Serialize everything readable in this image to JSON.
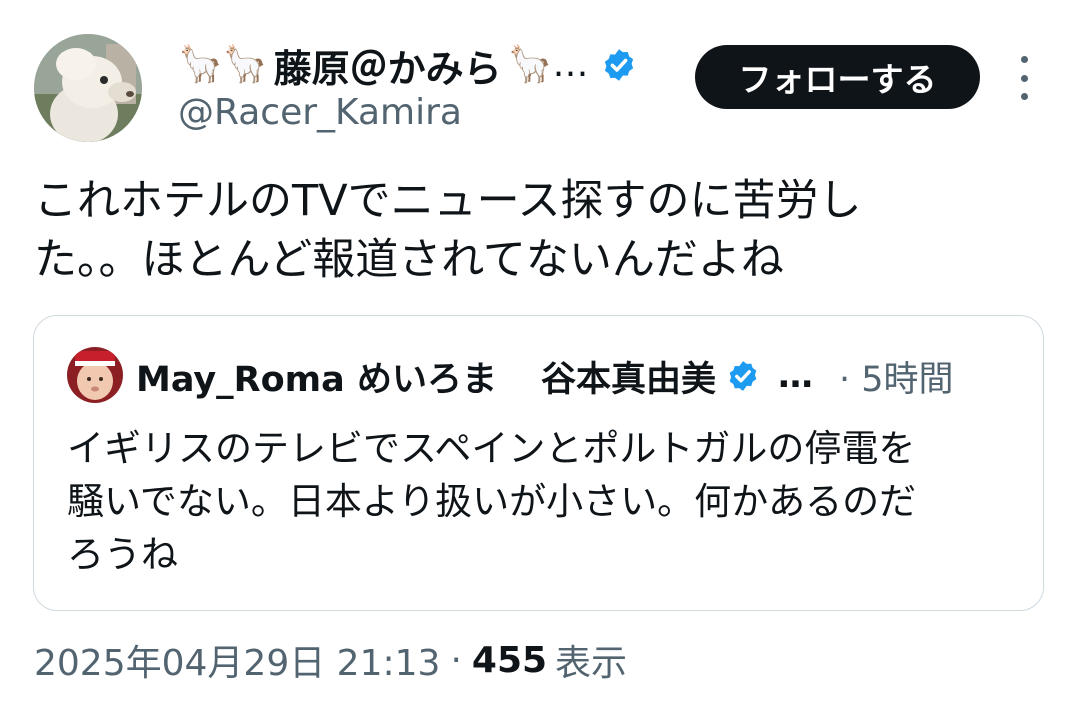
{
  "author": {
    "emoji_prefix": "🦙🦙",
    "display_name": "藤原＠かみら",
    "emoji_suffix": "🦙…",
    "handle": "@Racer_Kamira",
    "avatar_icon": "alpaca-avatar",
    "verified_icon": "verified-badge-icon"
  },
  "follow_button": {
    "label": "フォローする"
  },
  "tweet": {
    "text": "これホテルのTVでニュース探すのに苦労し\nた。。ほとんど報道されてないんだよね"
  },
  "quote": {
    "display_name": "May_Roma めいろま",
    "display_name_2": "谷本真由美",
    "ellipsis": "…",
    "time": "· 5時間",
    "text": "イギリスのテレビでスペインとポルトガルの停電を\n騒いでない。日本より扱いが小さい。何かあるのだ\nろうね"
  },
  "meta": {
    "date": "2025年04月29日 21:13",
    "separator": "·",
    "views": "455",
    "views_label": "表示"
  },
  "colors": {
    "verified": "#1d9bf0",
    "secondary_text": "#536471",
    "follow_bg": "#0f1419",
    "border": "#cfd9de"
  }
}
